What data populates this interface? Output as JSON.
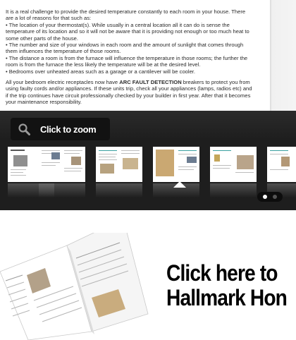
{
  "document": {
    "paragraphs": [
      "It is a real challenge to provide the desired temperature constantly to each room in your house.  There are a lot of reasons for that such as:",
      "•  The location of your thermostat(s).  While usually in a central location all it can do is sense the temperature of its location and so it will not be aware that it is providing not enough or too much heat to some other parts of the house.",
      "•  The number and size of your windows in each room and the amount of sunlight that comes through them influences the temperature of those rooms.",
      "•  The distance a room is from the furnace will influence the temperature in those rooms; the further the room is from the furnace the less likely the temperature will be at the desired level.",
      "•  Bedrooms over unheated areas such as a garage or a cantilever will be cooler."
    ],
    "afci_para": {
      "before": "All your bedroom electric receptacles now have ",
      "bold": "ARC FAULT DETECTION",
      "after": " breakers to protect you from using faulty cords and/or appliances.  If these units trip, check all your appliances (lamps, radios etc) and if the trip continues have circuit professionally checked by your builder in first year.  After that it becomes your maintenance responsibility."
    }
  },
  "viewer": {
    "zoom_label": "Click to zoom",
    "zoom_icon": "magnifier-icon",
    "thumbnail_count": 6,
    "selected_thumbnail": 3,
    "page_dots": 2,
    "active_dot": 1,
    "colors": {
      "background": "#1e1e1e",
      "button": "#121212",
      "dot_active": "#ffffff",
      "dot_inactive": "#555555"
    }
  },
  "cta": {
    "line1": "Click here to",
    "line2": "Hallmark Hon"
  }
}
